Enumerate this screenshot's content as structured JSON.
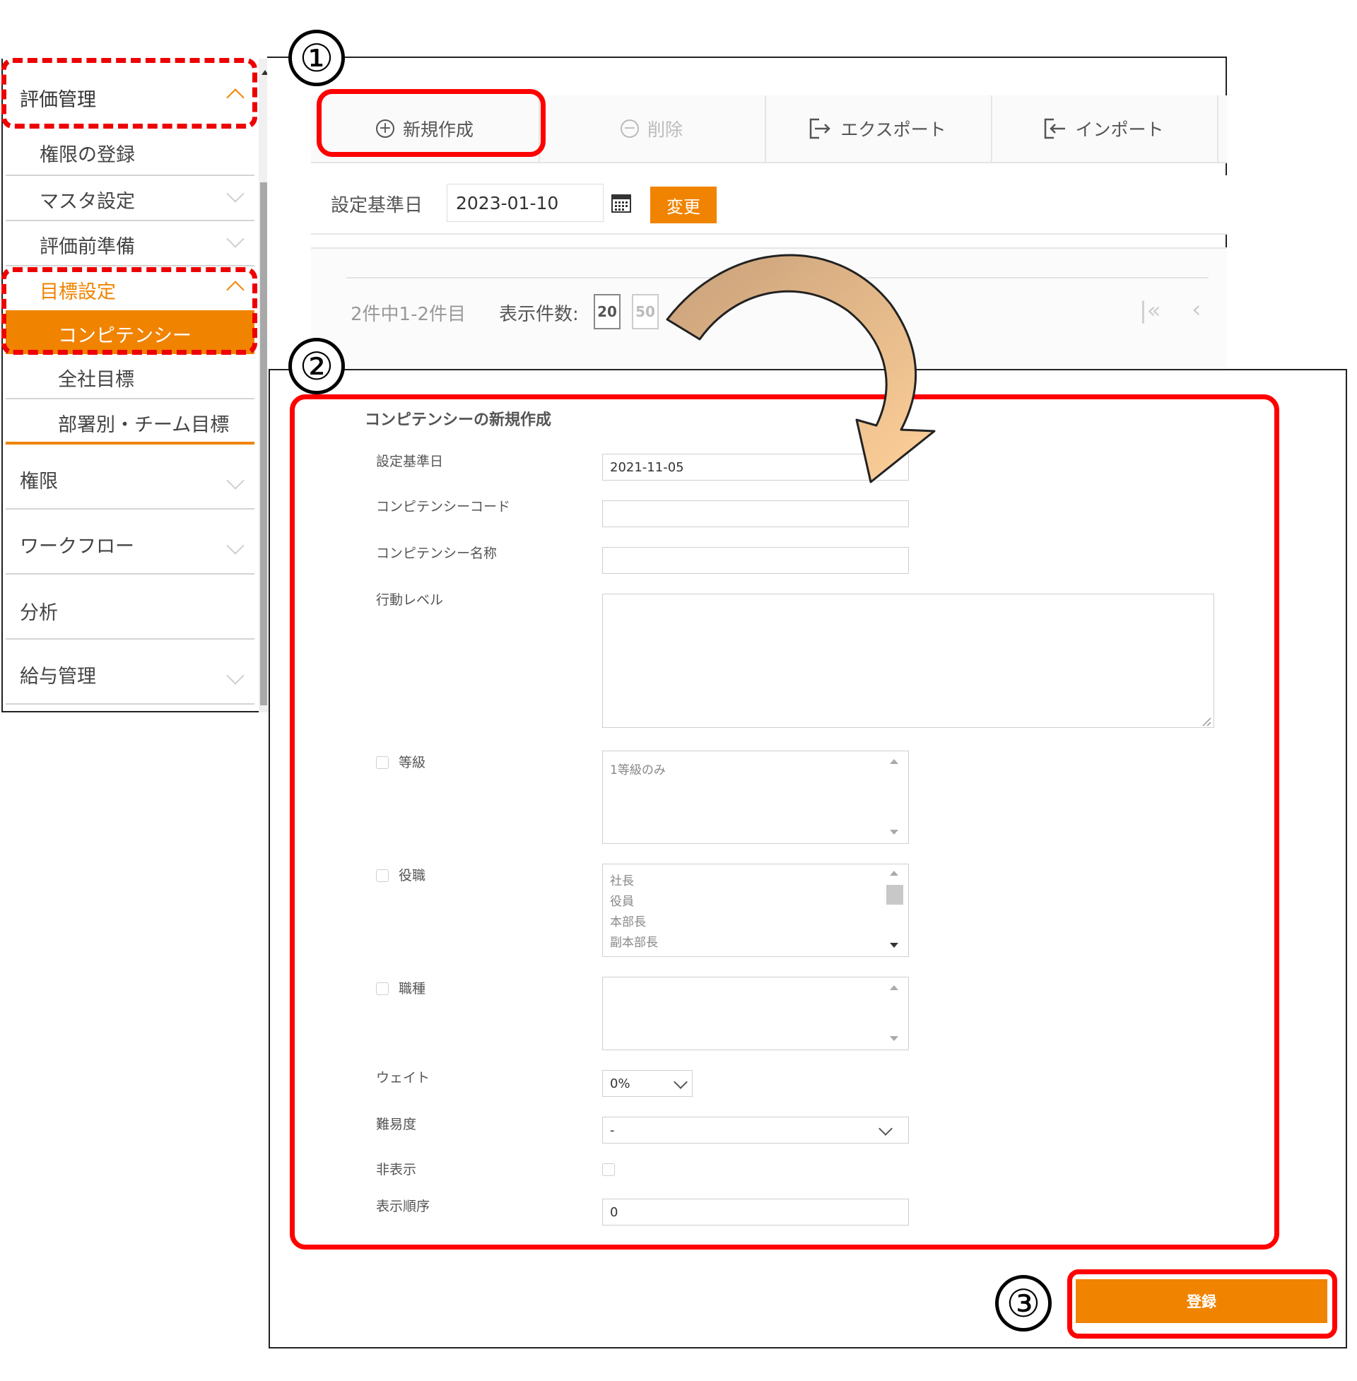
{
  "sidebar": {
    "items": [
      {
        "label": "評価管理"
      },
      {
        "label": "権限の登録"
      },
      {
        "label": "マスタ設定"
      },
      {
        "label": "評価前準備"
      },
      {
        "label": "目標設定"
      },
      {
        "label": "コンピテンシー"
      },
      {
        "label": "全社目標"
      },
      {
        "label": "部署別・チーム目標"
      },
      {
        "label": "権限"
      },
      {
        "label": "ワークフロー"
      },
      {
        "label": "分析"
      },
      {
        "label": "給与管理"
      }
    ]
  },
  "toolbar": {
    "new_label": "新規作成",
    "delete_label": "削除",
    "export_label": "エクスポート",
    "import_label": "インポート"
  },
  "datebar": {
    "label": "設定基準日",
    "value": "2023-01-10",
    "change_label": "変更"
  },
  "list": {
    "count_text": "2件中1-2件目",
    "per_page_label": "表示件数:",
    "per_page_options": [
      "20",
      "50"
    ]
  },
  "form": {
    "title": "コンピテンシーの新規作成",
    "date_label": "設定基準日",
    "date_value": "2021-11-05",
    "code_label": "コンピテンシーコード",
    "name_label": "コンピテンシー名称",
    "level_label": "行動レベル",
    "grade_label": "等級",
    "grade_options": [
      "1等級のみ"
    ],
    "position_label": "役職",
    "position_options": [
      "社長",
      "役員",
      "本部長",
      "副本部長"
    ],
    "jobtype_label": "職種",
    "weight_label": "ウェイト",
    "weight_value": "0%",
    "difficulty_label": "難易度",
    "difficulty_value": "-",
    "hidden_label": "非表示",
    "order_label": "表示順序",
    "order_value": "0",
    "submit_label": "登録"
  },
  "annotations": {
    "step1": "①",
    "step2": "②",
    "step3": "③"
  },
  "colors": {
    "accent": "#f08300",
    "annotation_red": "#ff0000",
    "arrow_fill_start": "#c8a07a",
    "arrow_fill_end": "#ffd199"
  }
}
